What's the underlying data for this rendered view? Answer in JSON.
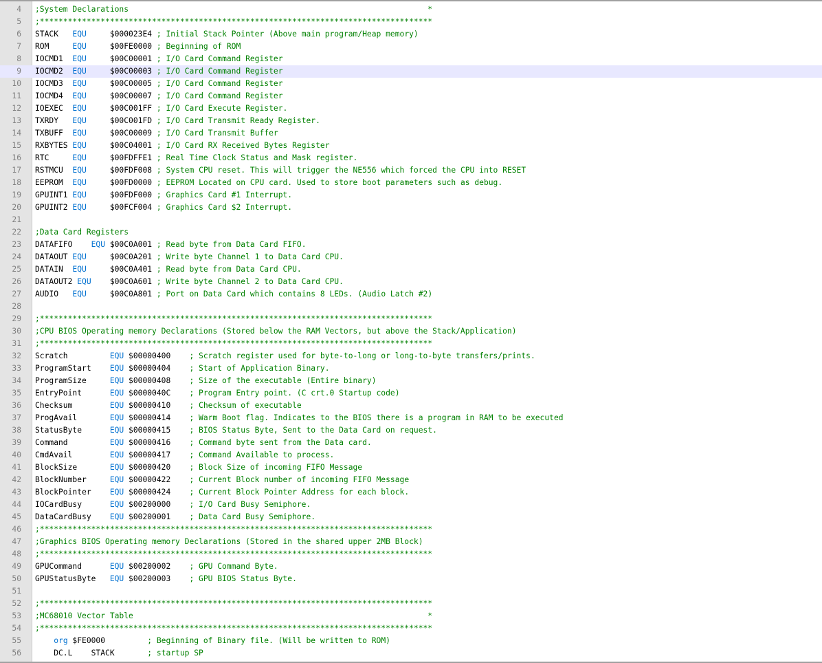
{
  "colors": {
    "keyword": "#0070d0",
    "comment": "#008000",
    "text": "#000000",
    "gutter": "#e4e4e4",
    "current_line": "#e8e8ff"
  },
  "current_line": 9,
  "lines": [
    {
      "n": "4",
      "parts": [
        [
          "cm",
          ";System Declarations                                                                *"
        ]
      ]
    },
    {
      "n": "5",
      "parts": [
        [
          "cm",
          ";************************************************************************************"
        ]
      ]
    },
    {
      "n": "6",
      "parts": [
        [
          "tx",
          "STACK   "
        ],
        [
          "kw",
          "EQU"
        ],
        [
          "tx",
          "     $000023E4 "
        ],
        [
          "cm",
          "; Initial Stack Pointer (Above main program/Heap memory)"
        ]
      ]
    },
    {
      "n": "7",
      "parts": [
        [
          "tx",
          "ROM     "
        ],
        [
          "kw",
          "EQU"
        ],
        [
          "tx",
          "     $00FE0000 "
        ],
        [
          "cm",
          "; Beginning of ROM"
        ]
      ]
    },
    {
      "n": "8",
      "parts": [
        [
          "tx",
          "IOCMD1  "
        ],
        [
          "kw",
          "EQU"
        ],
        [
          "tx",
          "     $00C00001 "
        ],
        [
          "cm",
          "; I/O Card Command Register"
        ]
      ]
    },
    {
      "n": "9",
      "parts": [
        [
          "tx",
          "IOCMD2  "
        ],
        [
          "kw",
          "EQU"
        ],
        [
          "tx",
          "     $00C00003 "
        ],
        [
          "cm",
          "; I/O Card Command Register"
        ]
      ]
    },
    {
      "n": "10",
      "parts": [
        [
          "tx",
          "IOCMD3  "
        ],
        [
          "kw",
          "EQU"
        ],
        [
          "tx",
          "     $00C00005 "
        ],
        [
          "cm",
          "; I/O Card Command Register"
        ]
      ]
    },
    {
      "n": "11",
      "parts": [
        [
          "tx",
          "IOCMD4  "
        ],
        [
          "kw",
          "EQU"
        ],
        [
          "tx",
          "     $00C00007 "
        ],
        [
          "cm",
          "; I/O Card Command Register"
        ]
      ]
    },
    {
      "n": "12",
      "parts": [
        [
          "tx",
          "IOEXEC  "
        ],
        [
          "kw",
          "EQU"
        ],
        [
          "tx",
          "     $00C001FF "
        ],
        [
          "cm",
          "; I/O Card Execute Register."
        ]
      ]
    },
    {
      "n": "13",
      "parts": [
        [
          "tx",
          "TXRDY   "
        ],
        [
          "kw",
          "EQU"
        ],
        [
          "tx",
          "     $00C001FD "
        ],
        [
          "cm",
          "; I/O Card Transmit Ready Register."
        ]
      ]
    },
    {
      "n": "14",
      "parts": [
        [
          "tx",
          "TXBUFF  "
        ],
        [
          "kw",
          "EQU"
        ],
        [
          "tx",
          "     $00C00009 "
        ],
        [
          "cm",
          "; I/O Card Transmit Buffer"
        ]
      ]
    },
    {
      "n": "15",
      "parts": [
        [
          "tx",
          "RXBYTES "
        ],
        [
          "kw",
          "EQU"
        ],
        [
          "tx",
          "     $00C04001 "
        ],
        [
          "cm",
          "; I/O Card RX Received Bytes Register"
        ]
      ]
    },
    {
      "n": "16",
      "parts": [
        [
          "tx",
          "RTC     "
        ],
        [
          "kw",
          "EQU"
        ],
        [
          "tx",
          "     $00FDFFE1 "
        ],
        [
          "cm",
          "; Real Time Clock Status and Mask register."
        ]
      ]
    },
    {
      "n": "17",
      "parts": [
        [
          "tx",
          "RSTMCU  "
        ],
        [
          "kw",
          "EQU"
        ],
        [
          "tx",
          "     $00FDF008 "
        ],
        [
          "cm",
          "; System CPU reset. This will trigger the NE556 which forced the CPU into RESET"
        ]
      ]
    },
    {
      "n": "18",
      "parts": [
        [
          "tx",
          "EEPROM  "
        ],
        [
          "kw",
          "EQU"
        ],
        [
          "tx",
          "     $00FD0000 "
        ],
        [
          "cm",
          "; EEPROM Located on CPU card. Used to store boot parameters such as debug."
        ]
      ]
    },
    {
      "n": "19",
      "parts": [
        [
          "tx",
          "GPUINT1 "
        ],
        [
          "kw",
          "EQU"
        ],
        [
          "tx",
          "     $00FDF000 "
        ],
        [
          "cm",
          "; Graphics Card #1 Interrupt."
        ]
      ]
    },
    {
      "n": "20",
      "parts": [
        [
          "tx",
          "GPUINT2 "
        ],
        [
          "kw",
          "EQU"
        ],
        [
          "tx",
          "     $00FCF004 "
        ],
        [
          "cm",
          "; Graphics Card $2 Interrupt."
        ]
      ]
    },
    {
      "n": "21",
      "parts": []
    },
    {
      "n": "22",
      "parts": [
        [
          "cm",
          ";Data Card Registers"
        ]
      ]
    },
    {
      "n": "23",
      "parts": [
        [
          "tx",
          "DATAFIFO    "
        ],
        [
          "kw",
          "EQU"
        ],
        [
          "tx",
          " $00C0A001 "
        ],
        [
          "cm",
          "; Read byte from Data Card FIFO."
        ]
      ]
    },
    {
      "n": "24",
      "parts": [
        [
          "tx",
          "DATAOUT "
        ],
        [
          "kw",
          "EQU"
        ],
        [
          "tx",
          "     $00C0A201 "
        ],
        [
          "cm",
          "; Write byte Channel 1 to Data Card CPU."
        ]
      ]
    },
    {
      "n": "25",
      "parts": [
        [
          "tx",
          "DATAIN  "
        ],
        [
          "kw",
          "EQU"
        ],
        [
          "tx",
          "     $00C0A401 "
        ],
        [
          "cm",
          "; Read byte from Data Card CPU."
        ]
      ]
    },
    {
      "n": "26",
      "parts": [
        [
          "tx",
          "DATAOUT2 "
        ],
        [
          "kw",
          "EQU"
        ],
        [
          "tx",
          "    $00C0A601 "
        ],
        [
          "cm",
          "; Write byte Channel 2 to Data Card CPU."
        ]
      ]
    },
    {
      "n": "27",
      "parts": [
        [
          "tx",
          "AUDIO   "
        ],
        [
          "kw",
          "EQU"
        ],
        [
          "tx",
          "     $00C0A801 "
        ],
        [
          "cm",
          "; Port on Data Card which contains 8 LEDs. (Audio Latch #2)"
        ]
      ]
    },
    {
      "n": "28",
      "parts": []
    },
    {
      "n": "29",
      "parts": [
        [
          "cm",
          ";************************************************************************************"
        ]
      ]
    },
    {
      "n": "30",
      "parts": [
        [
          "cm",
          ";CPU BIOS Operating memory Declarations (Stored below the RAM Vectors, but above the Stack/Application)"
        ]
      ]
    },
    {
      "n": "31",
      "parts": [
        [
          "cm",
          ";************************************************************************************"
        ]
      ]
    },
    {
      "n": "32",
      "parts": [
        [
          "tx",
          "Scratch         "
        ],
        [
          "kw",
          "EQU"
        ],
        [
          "tx",
          " $00000400    "
        ],
        [
          "cm",
          "; Scratch register used for byte-to-long or long-to-byte transfers/prints."
        ]
      ]
    },
    {
      "n": "33",
      "parts": [
        [
          "tx",
          "ProgramStart    "
        ],
        [
          "kw",
          "EQU"
        ],
        [
          "tx",
          " $00000404    "
        ],
        [
          "cm",
          "; Start of Application Binary."
        ]
      ]
    },
    {
      "n": "34",
      "parts": [
        [
          "tx",
          "ProgramSize     "
        ],
        [
          "kw",
          "EQU"
        ],
        [
          "tx",
          " $00000408    "
        ],
        [
          "cm",
          "; Size of the executable (Entire binary)"
        ]
      ]
    },
    {
      "n": "35",
      "parts": [
        [
          "tx",
          "EntryPoint      "
        ],
        [
          "kw",
          "EQU"
        ],
        [
          "tx",
          " $0000040C    "
        ],
        [
          "cm",
          "; Program Entry point. (C crt.0 Startup code)"
        ]
      ]
    },
    {
      "n": "36",
      "parts": [
        [
          "tx",
          "Checksum        "
        ],
        [
          "kw",
          "EQU"
        ],
        [
          "tx",
          " $00000410    "
        ],
        [
          "cm",
          "; Checksum of executable"
        ]
      ]
    },
    {
      "n": "37",
      "parts": [
        [
          "tx",
          "ProgAvail       "
        ],
        [
          "kw",
          "EQU"
        ],
        [
          "tx",
          " $00000414    "
        ],
        [
          "cm",
          "; Warm Boot flag. Indicates to the BIOS there is a program in RAM to be executed"
        ]
      ]
    },
    {
      "n": "38",
      "parts": [
        [
          "tx",
          "StatusByte      "
        ],
        [
          "kw",
          "EQU"
        ],
        [
          "tx",
          " $00000415    "
        ],
        [
          "cm",
          "; BIOS Status Byte, Sent to the Data Card on request."
        ]
      ]
    },
    {
      "n": "39",
      "parts": [
        [
          "tx",
          "Command         "
        ],
        [
          "kw",
          "EQU"
        ],
        [
          "tx",
          " $00000416    "
        ],
        [
          "cm",
          "; Command byte sent from the Data card."
        ]
      ]
    },
    {
      "n": "40",
      "parts": [
        [
          "tx",
          "CmdAvail        "
        ],
        [
          "kw",
          "EQU"
        ],
        [
          "tx",
          " $00000417    "
        ],
        [
          "cm",
          "; Command Available to process."
        ]
      ]
    },
    {
      "n": "41",
      "parts": [
        [
          "tx",
          "BlockSize       "
        ],
        [
          "kw",
          "EQU"
        ],
        [
          "tx",
          " $00000420    "
        ],
        [
          "cm",
          "; Block Size of incoming FIFO Message"
        ]
      ]
    },
    {
      "n": "42",
      "parts": [
        [
          "tx",
          "BlockNumber     "
        ],
        [
          "kw",
          "EQU"
        ],
        [
          "tx",
          " $00000422    "
        ],
        [
          "cm",
          "; Current Block number of incoming FIFO Message"
        ]
      ]
    },
    {
      "n": "43",
      "parts": [
        [
          "tx",
          "BlockPointer    "
        ],
        [
          "kw",
          "EQU"
        ],
        [
          "tx",
          " $00000424    "
        ],
        [
          "cm",
          "; Current Block Pointer Address for each block."
        ]
      ]
    },
    {
      "n": "44",
      "parts": [
        [
          "tx",
          "IOCardBusy      "
        ],
        [
          "kw",
          "EQU"
        ],
        [
          "tx",
          " $00200000    "
        ],
        [
          "cm",
          "; I/O Card Busy Semiphore."
        ]
      ]
    },
    {
      "n": "45",
      "parts": [
        [
          "tx",
          "DataCardBusy    "
        ],
        [
          "kw",
          "EQU"
        ],
        [
          "tx",
          " $00200001    "
        ],
        [
          "cm",
          "; Data Card Busy Semiphore."
        ]
      ]
    },
    {
      "n": "46",
      "parts": [
        [
          "cm",
          ";************************************************************************************"
        ]
      ]
    },
    {
      "n": "47",
      "parts": [
        [
          "cm",
          ";Graphics BIOS Operating memory Declarations (Stored in the shared upper 2MB Block)"
        ]
      ]
    },
    {
      "n": "48",
      "parts": [
        [
          "cm",
          ";************************************************************************************"
        ]
      ]
    },
    {
      "n": "49",
      "parts": [
        [
          "tx",
          "GPUCommand      "
        ],
        [
          "kw",
          "EQU"
        ],
        [
          "tx",
          " $00200002    "
        ],
        [
          "cm",
          "; GPU Command Byte."
        ]
      ]
    },
    {
      "n": "50",
      "parts": [
        [
          "tx",
          "GPUStatusByte   "
        ],
        [
          "kw",
          "EQU"
        ],
        [
          "tx",
          " $00200003    "
        ],
        [
          "cm",
          "; GPU BIOS Status Byte."
        ]
      ]
    },
    {
      "n": "51",
      "parts": []
    },
    {
      "n": "52",
      "parts": [
        [
          "cm",
          ";************************************************************************************"
        ]
      ]
    },
    {
      "n": "53",
      "parts": [
        [
          "cm",
          ";MC68010 Vector Table                                                               *"
        ]
      ]
    },
    {
      "n": "54",
      "parts": [
        [
          "cm",
          ";************************************************************************************"
        ]
      ]
    },
    {
      "n": "55",
      "parts": [
        [
          "tx",
          "    "
        ],
        [
          "kw",
          "org"
        ],
        [
          "tx",
          " $FE0000         "
        ],
        [
          "cm",
          "; Beginning of Binary file. (Will be written to ROM)"
        ]
      ]
    },
    {
      "n": "56",
      "parts": [
        [
          "tx",
          "    DC.L    STACK       "
        ],
        [
          "cm",
          "; startup SP"
        ]
      ]
    }
  ]
}
